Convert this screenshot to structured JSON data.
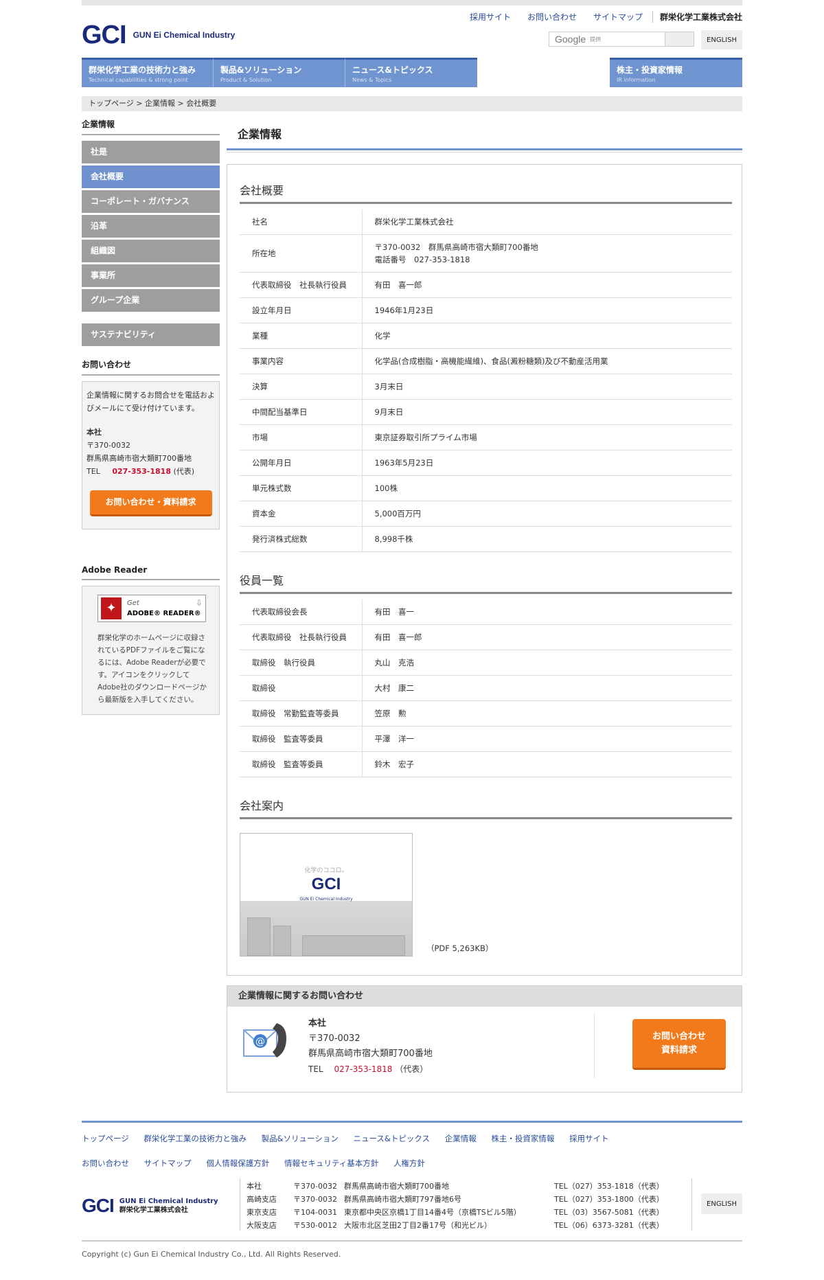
{
  "header": {
    "logo_mark": "GCI",
    "logo_text": "GUN Ei Chemical Industry",
    "top_links": [
      "採用サイト",
      "お問い合わせ",
      "サイトマップ"
    ],
    "company": "群栄化学工業株式会社",
    "search_word": "Google",
    "search_sub": "提供",
    "english": "ENGLISH"
  },
  "gnav": [
    {
      "ja": "群栄化学工業の技術力と強み",
      "en": "Technical capabilities & strong point"
    },
    {
      "ja": "製品&ソリューション",
      "en": "Product & Solution"
    },
    {
      "ja": "ニュース&トピックス",
      "en": "News & Topics"
    }
  ],
  "gnav_ir": {
    "ja": "株主・投資家情報",
    "en": "IR information"
  },
  "breadcrumb": "トップページ > 企業情報 > 会社概要",
  "sidebar": {
    "heading": "企業情報",
    "items": [
      "社是",
      "会社概要",
      "コーポレート・ガバナンス",
      "沿革",
      "組織図",
      "事業所",
      "グループ企業"
    ],
    "extra": "サステナビリティ",
    "contact_heading": "お問い合わせ",
    "contact_text": "企業情報に関するお問合せを電話およびメールにて受け付けています。",
    "hq_label": "本社",
    "zip": "〒370-0032",
    "address": "群馬県高崎市宿大類町700番地",
    "tel_label": "TEL",
    "tel": "027-353-1818",
    "tel_note": "(代表)",
    "contact_button": "お問い合わせ・資料請求",
    "adobe_heading": "Adobe Reader",
    "adobe_get": "Get",
    "adobe_name": "ADOBE® READER®",
    "adobe_text": "群栄化学のホームページに収録されているPDFファイルをご覧になるには、Adobe Readerが必要です。アイコンをクリックしてAdobe社のダウンロードページから最新版を入手してください。"
  },
  "main": {
    "title": "企業情報",
    "overview_heading": "会社概要",
    "overview": [
      {
        "k": "社名",
        "v": "群栄化学工業株式会社"
      },
      {
        "k": "所在地",
        "v": "〒370-0032　群馬県高崎市宿大類町700番地",
        "v2": "電話番号　027-353-1818"
      },
      {
        "k": "代表取締役　社長執行役員",
        "v": "有田　喜一郎"
      },
      {
        "k": "設立年月日",
        "v": "1946年1月23日"
      },
      {
        "k": "業種",
        "v": "化学"
      },
      {
        "k": "事業内容",
        "v": "化学品(合成樹脂・高機能繊維)、食品(澱粉糖類)及び不動産活用業"
      },
      {
        "k": "決算",
        "v": "3月末日"
      },
      {
        "k": "中間配当基準日",
        "v": "9月末日"
      },
      {
        "k": "市場",
        "v": "東京証券取引所プライム市場"
      },
      {
        "k": "公開年月日",
        "v": "1963年5月23日"
      },
      {
        "k": "単元株式数",
        "v": "100株"
      },
      {
        "k": "資本金",
        "v": "5,000百万円"
      },
      {
        "k": "発行済株式総数",
        "v": "8,998千株"
      }
    ],
    "officers_heading": "役員一覧",
    "officers": [
      {
        "k": "代表取締役会長",
        "v": "有田　喜一"
      },
      {
        "k": "代表取締役　社長執行役員",
        "v": "有田　喜一郎"
      },
      {
        "k": "取締役　執行役員",
        "v": "丸山　克浩"
      },
      {
        "k": "取締役",
        "v": "大村　康二"
      },
      {
        "k": "取締役　常勤監査等委員",
        "v": "笠原　勲"
      },
      {
        "k": "取締役　監査等委員",
        "v": "平澤　洋一"
      },
      {
        "k": "取締役　監査等委員",
        "v": "鈴木　宏子"
      }
    ],
    "guide_heading": "会社案内",
    "pamphlet_catch": "化学のココロ。",
    "pamphlet_mark": "GCI",
    "pamphlet_name": "GUN Ei Chemical Industry",
    "pdf_size": "（PDF 5,263KB）",
    "inquiry_heading": "企業情報に関するお問い合わせ",
    "inquiry_hq": "本社",
    "inquiry_zip": "〒370-0032",
    "inquiry_address": "群馬県高崎市宿大類町700番地",
    "inquiry_tel_label": "TEL",
    "inquiry_tel": "027-353-1818",
    "inquiry_tel_note": "（代表）",
    "inquiry_button_1": "お問い合わせ",
    "inquiry_button_2": "資料請求"
  },
  "footer": {
    "links_1": [
      "トップページ",
      "群栄化学工業の技術力と強み",
      "製品&ソリューション",
      "ニュース&トピックス",
      "企業情報",
      "株主・投資家情報",
      "採用サイト"
    ],
    "links_2": [
      "お問い合わせ",
      "サイトマップ",
      "個人情報保護方針",
      "情報セキュリティ基本方針",
      "人権方針"
    ],
    "logo_mark": "GCI",
    "logo_en": "GUN Ei Chemical Industry",
    "logo_ja": "群栄化学工業株式会社",
    "offices": [
      {
        "n": "本社",
        "z": "〒370-0032",
        "a": "群馬県高崎市宿大類町700番地",
        "t": "TEL（027）353-1818（代表）"
      },
      {
        "n": "高崎支店",
        "z": "〒370-0032",
        "a": "群馬県高崎市宿大類町797番地6号",
        "t": "TEL（027）353-1800（代表）"
      },
      {
        "n": "東京支店",
        "z": "〒104-0031",
        "a": "東京都中央区京橋1丁目14番4号（京橋TSビル5階）",
        "t": "TEL（03）3567-5081（代表）"
      },
      {
        "n": "大阪支店",
        "z": "〒530-0012",
        "a": "大阪市北区芝田2丁目2番17号（和光ビル）",
        "t": "TEL（06）6373-3281（代表）"
      }
    ],
    "english": "ENGLISH",
    "copyright": "Copyright (c) Gun Ei Chemical Industry Co., Ltd. All Rights Reserved."
  },
  "colors": {
    "brand": "#1a2a7a",
    "nav": "#7094cf",
    "accent": "#f27a1a",
    "tel": "#c8102e"
  }
}
